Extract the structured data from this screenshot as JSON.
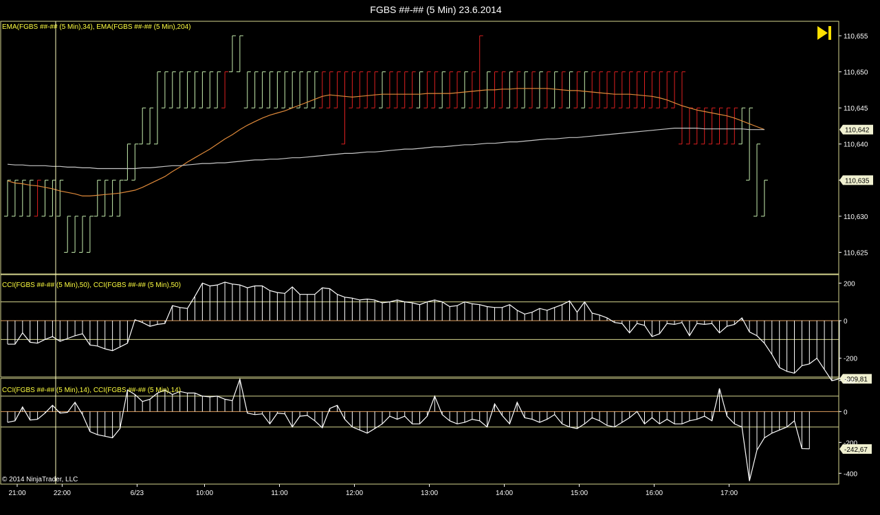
{
  "window": {
    "title": "FGBS ##-## (5 Min)  23.6.2014",
    "copyright": "© 2014 NinjaTrader, LLC",
    "end_icon": "skip-to-end-icon"
  },
  "colors": {
    "background": "#000000",
    "frame": "#d8d890",
    "up_bar": "#c8f0b0",
    "down_bar": "#e02020",
    "ema_fast": "#e08a3a",
    "ema_slow": "#c8c8c8",
    "indicator": "#ffffff",
    "crosshair": "#ffffc0",
    "zero_line": "#e0a060"
  },
  "x_axis": {
    "time_labels": [
      "21:00",
      "22:00",
      "6/23",
      "10:00",
      "11:00",
      "12:00",
      "13:00",
      "14:00",
      "15:00",
      "16:00",
      "17:00"
    ],
    "label_bars": [
      0,
      6,
      16,
      25,
      35,
      45,
      55,
      65,
      75,
      85,
      95
    ]
  },
  "chart_data": [
    {
      "type": "bar",
      "name": "price",
      "legend": "EMA(FGBS ##-## (5 Min),34), EMA(FGBS ##-## (5 Min),204)",
      "ylim": [
        110.622,
        110.657
      ],
      "ticks": [
        "110,625",
        "110,630",
        "110,635",
        "110,640",
        "110,645",
        "110,650",
        "110,655"
      ],
      "tick_values": [
        110.625,
        110.63,
        110.635,
        110.64,
        110.645,
        110.65,
        110.655
      ],
      "last_price_labels": [
        "110,642",
        "110,635"
      ],
      "last_price_values": [
        110.642,
        110.635
      ],
      "bars": {
        "high": [
          110.635,
          110.635,
          110.635,
          110.635,
          110.635,
          110.635,
          110.635,
          110.635,
          110.63,
          110.63,
          110.63,
          110.63,
          110.635,
          110.635,
          110.635,
          110.635,
          110.64,
          110.64,
          110.645,
          110.645,
          110.65,
          110.65,
          110.65,
          110.65,
          110.65,
          110.65,
          110.65,
          110.65,
          110.65,
          110.65,
          110.655,
          110.655,
          110.65,
          110.65,
          110.65,
          110.65,
          110.65,
          110.65,
          110.65,
          110.65,
          110.65,
          110.65,
          110.65,
          110.65,
          110.65,
          110.65,
          110.65,
          110.65,
          110.65,
          110.65,
          110.65,
          110.65,
          110.65,
          110.65,
          110.65,
          110.65,
          110.65,
          110.65,
          110.65,
          110.65,
          110.65,
          110.65,
          110.65,
          110.655,
          110.65,
          110.65,
          110.65,
          110.65,
          110.65,
          110.65,
          110.65,
          110.65,
          110.65,
          110.65,
          110.65,
          110.65,
          110.65,
          110.65,
          110.65,
          110.65,
          110.65,
          110.65,
          110.65,
          110.65,
          110.65,
          110.65,
          110.65,
          110.65,
          110.65,
          110.65,
          110.65,
          110.645,
          110.645,
          110.645,
          110.645,
          110.645,
          110.645,
          110.645,
          110.645,
          110.645,
          110.64,
          110.635
        ],
        "low": [
          110.63,
          110.63,
          110.63,
          110.63,
          110.63,
          110.63,
          110.63,
          110.63,
          110.625,
          110.625,
          110.625,
          110.625,
          110.63,
          110.63,
          110.63,
          110.63,
          110.635,
          110.635,
          110.64,
          110.64,
          110.64,
          110.645,
          110.645,
          110.645,
          110.645,
          110.645,
          110.645,
          110.645,
          110.645,
          110.645,
          110.65,
          110.65,
          110.645,
          110.645,
          110.645,
          110.645,
          110.645,
          110.645,
          110.645,
          110.645,
          110.645,
          110.645,
          110.645,
          110.645,
          110.645,
          110.64,
          110.645,
          110.645,
          110.645,
          110.645,
          110.645,
          110.645,
          110.645,
          110.645,
          110.645,
          110.645,
          110.645,
          110.645,
          110.645,
          110.645,
          110.645,
          110.645,
          110.645,
          110.645,
          110.645,
          110.645,
          110.645,
          110.645,
          110.645,
          110.645,
          110.645,
          110.645,
          110.645,
          110.645,
          110.645,
          110.645,
          110.645,
          110.645,
          110.645,
          110.645,
          110.645,
          110.645,
          110.645,
          110.645,
          110.645,
          110.645,
          110.645,
          110.645,
          110.645,
          110.645,
          110.64,
          110.64,
          110.64,
          110.64,
          110.64,
          110.64,
          110.64,
          110.64,
          110.64,
          110.635,
          110.63,
          110.63
        ],
        "down": [
          4,
          29,
          42,
          43,
          44,
          45,
          46,
          47,
          48,
          49,
          51,
          52,
          53,
          54,
          56,
          57,
          59,
          60,
          62,
          63,
          65,
          66,
          68,
          70,
          72,
          74,
          76,
          78,
          79,
          80,
          81,
          82,
          83,
          84,
          85,
          86,
          87,
          88,
          89,
          90,
          91,
          92,
          93,
          94,
          95,
          96,
          97
        ]
      },
      "series": [
        {
          "role": "fast_ema",
          "values": [
            110.6349,
            110.6346,
            110.6345,
            110.6343,
            110.6342,
            110.634,
            110.6338,
            110.6335,
            110.6333,
            110.6331,
            110.6328,
            110.6328,
            110.6329,
            110.633,
            110.6331,
            110.6332,
            110.6334,
            110.6336,
            110.634,
            110.6345,
            110.635,
            110.6355,
            110.6362,
            110.6368,
            110.6375,
            110.6381,
            110.6387,
            110.6393,
            110.64,
            110.6407,
            110.6413,
            110.642,
            110.6426,
            110.6431,
            110.6436,
            110.644,
            110.6443,
            110.6446,
            110.645,
            110.6454,
            110.6458,
            110.6462,
            110.6466,
            110.6468,
            110.6467,
            110.6466,
            110.6465,
            110.6466,
            110.6467,
            110.6468,
            110.6469,
            110.6469,
            110.6469,
            110.6469,
            110.6469,
            110.6469,
            110.647,
            110.647,
            110.647,
            110.647,
            110.6471,
            110.6472,
            110.6473,
            110.6474,
            110.6475,
            110.6475,
            110.6476,
            110.6476,
            110.6477,
            110.6477,
            110.6477,
            110.6477,
            110.6477,
            110.6476,
            110.6475,
            110.6474,
            110.6474,
            110.6473,
            110.6472,
            110.6471,
            110.647,
            110.6469,
            110.6469,
            110.6469,
            110.6468,
            110.6467,
            110.6466,
            110.6464,
            110.6461,
            110.6457,
            110.6453,
            110.645,
            110.6447,
            110.6445,
            110.6443,
            110.6441,
            110.6439,
            110.6436,
            110.6432,
            110.6428,
            110.6424,
            110.642
          ]
        },
        {
          "role": "slow_ema",
          "values": [
            110.6372,
            110.6371,
            110.6371,
            110.637,
            110.637,
            110.637,
            110.6369,
            110.6369,
            110.6368,
            110.6368,
            110.6367,
            110.6367,
            110.6366,
            110.6366,
            110.6366,
            110.6366,
            110.6366,
            110.6366,
            110.6367,
            110.6367,
            110.6368,
            110.6369,
            110.637,
            110.637,
            110.6371,
            110.6372,
            110.6373,
            110.6373,
            110.6374,
            110.6374,
            110.6375,
            110.6376,
            110.6377,
            110.6378,
            110.6378,
            110.6379,
            110.6379,
            110.638,
            110.6381,
            110.6381,
            110.6382,
            110.6383,
            110.6384,
            110.6385,
            110.6386,
            110.6387,
            110.6387,
            110.6388,
            110.6389,
            110.6389,
            110.639,
            110.6391,
            110.6392,
            110.6393,
            110.6393,
            110.6394,
            110.6395,
            110.6396,
            110.6396,
            110.6397,
            110.6398,
            110.6399,
            110.6399,
            110.64,
            110.6401,
            110.6401,
            110.6402,
            110.6403,
            110.6403,
            110.6404,
            110.6405,
            110.6406,
            110.6407,
            110.6407,
            110.6408,
            110.6409,
            110.6409,
            110.641,
            110.6411,
            110.6412,
            110.6413,
            110.6414,
            110.6415,
            110.6416,
            110.6417,
            110.6418,
            110.6419,
            110.642,
            110.6421,
            110.6422,
            110.6422,
            110.6422,
            110.6422,
            110.6421,
            110.6421,
            110.6421,
            110.6421,
            110.6421,
            110.6421,
            110.642,
            110.642,
            110.642
          ]
        }
      ]
    },
    {
      "type": "bar",
      "name": "cci50",
      "legend": "CCI(FGBS ##-## (5 Min),50), CCI(FGBS ##-## (5 Min),50)",
      "ylim": [
        -300,
        245
      ],
      "ticks": [
        "200",
        "0",
        "-200"
      ],
      "tick_values": [
        200,
        0,
        -200
      ],
      "levels": [
        100,
        0,
        -100
      ],
      "last_value_label": "-309,81",
      "last_value": -309.81,
      "values": [
        -125,
        -125,
        -65,
        -115,
        -120,
        -100,
        -85,
        -110,
        -95,
        -80,
        -70,
        -130,
        -135,
        -150,
        -160,
        -140,
        -120,
        5,
        -10,
        -30,
        -20,
        -15,
        80,
        70,
        65,
        130,
        200,
        185,
        190,
        205,
        195,
        190,
        175,
        185,
        185,
        160,
        150,
        145,
        180,
        140,
        140,
        140,
        175,
        170,
        140,
        125,
        120,
        110,
        115,
        110,
        95,
        100,
        110,
        100,
        95,
        85,
        100,
        110,
        100,
        75,
        80,
        100,
        90,
        85,
        75,
        70,
        70,
        85,
        55,
        35,
        45,
        65,
        55,
        70,
        85,
        105,
        45,
        100,
        40,
        30,
        15,
        -10,
        -15,
        -65,
        -15,
        -25,
        -85,
        -70,
        -15,
        -20,
        -10,
        -80,
        -15,
        -20,
        -15,
        -65,
        -30,
        -20,
        15,
        -60,
        -80,
        -120,
        -180,
        -250,
        -270,
        -280,
        -240,
        -230,
        -200,
        -260,
        -320,
        -309
      ]
    },
    {
      "type": "bar",
      "name": "cci14",
      "legend": "CCI(FGBS ##-## (5 Min),14), CCI(FGBS ##-## (5 Min),14)",
      "ylim": [
        -470,
        215
      ],
      "ticks": [
        "200",
        "0",
        "-200",
        "-400"
      ],
      "tick_values": [
        200,
        0,
        -200,
        -400
      ],
      "levels": [
        100,
        0,
        -100
      ],
      "last_value_label": "-242,67",
      "last_value": -242.67,
      "values": [
        -70,
        -60,
        30,
        -55,
        -50,
        -10,
        40,
        -10,
        -5,
        60,
        -20,
        -130,
        -150,
        -160,
        -170,
        -110,
        140,
        110,
        65,
        80,
        120,
        140,
        110,
        130,
        120,
        120,
        100,
        95,
        100,
        80,
        70,
        210,
        -10,
        -20,
        -15,
        -80,
        -10,
        -15,
        -100,
        -30,
        -25,
        -60,
        -105,
        20,
        40,
        -50,
        -100,
        -120,
        -140,
        -110,
        -80,
        -30,
        -50,
        -30,
        -80,
        -80,
        -30,
        100,
        -20,
        -60,
        -80,
        -70,
        -50,
        -60,
        -100,
        50,
        -25,
        -80,
        60,
        -40,
        -50,
        -70,
        -50,
        -20,
        -80,
        -100,
        -110,
        -80,
        -40,
        -60,
        -90,
        -100,
        -70,
        -40,
        0,
        -80,
        -40,
        -80,
        -50,
        -80,
        -80,
        -60,
        -50,
        -30,
        -60,
        150,
        -30,
        -80,
        -100,
        -450,
        -250,
        -170,
        -140,
        -120,
        -100,
        -60,
        -240,
        -242
      ]
    }
  ]
}
